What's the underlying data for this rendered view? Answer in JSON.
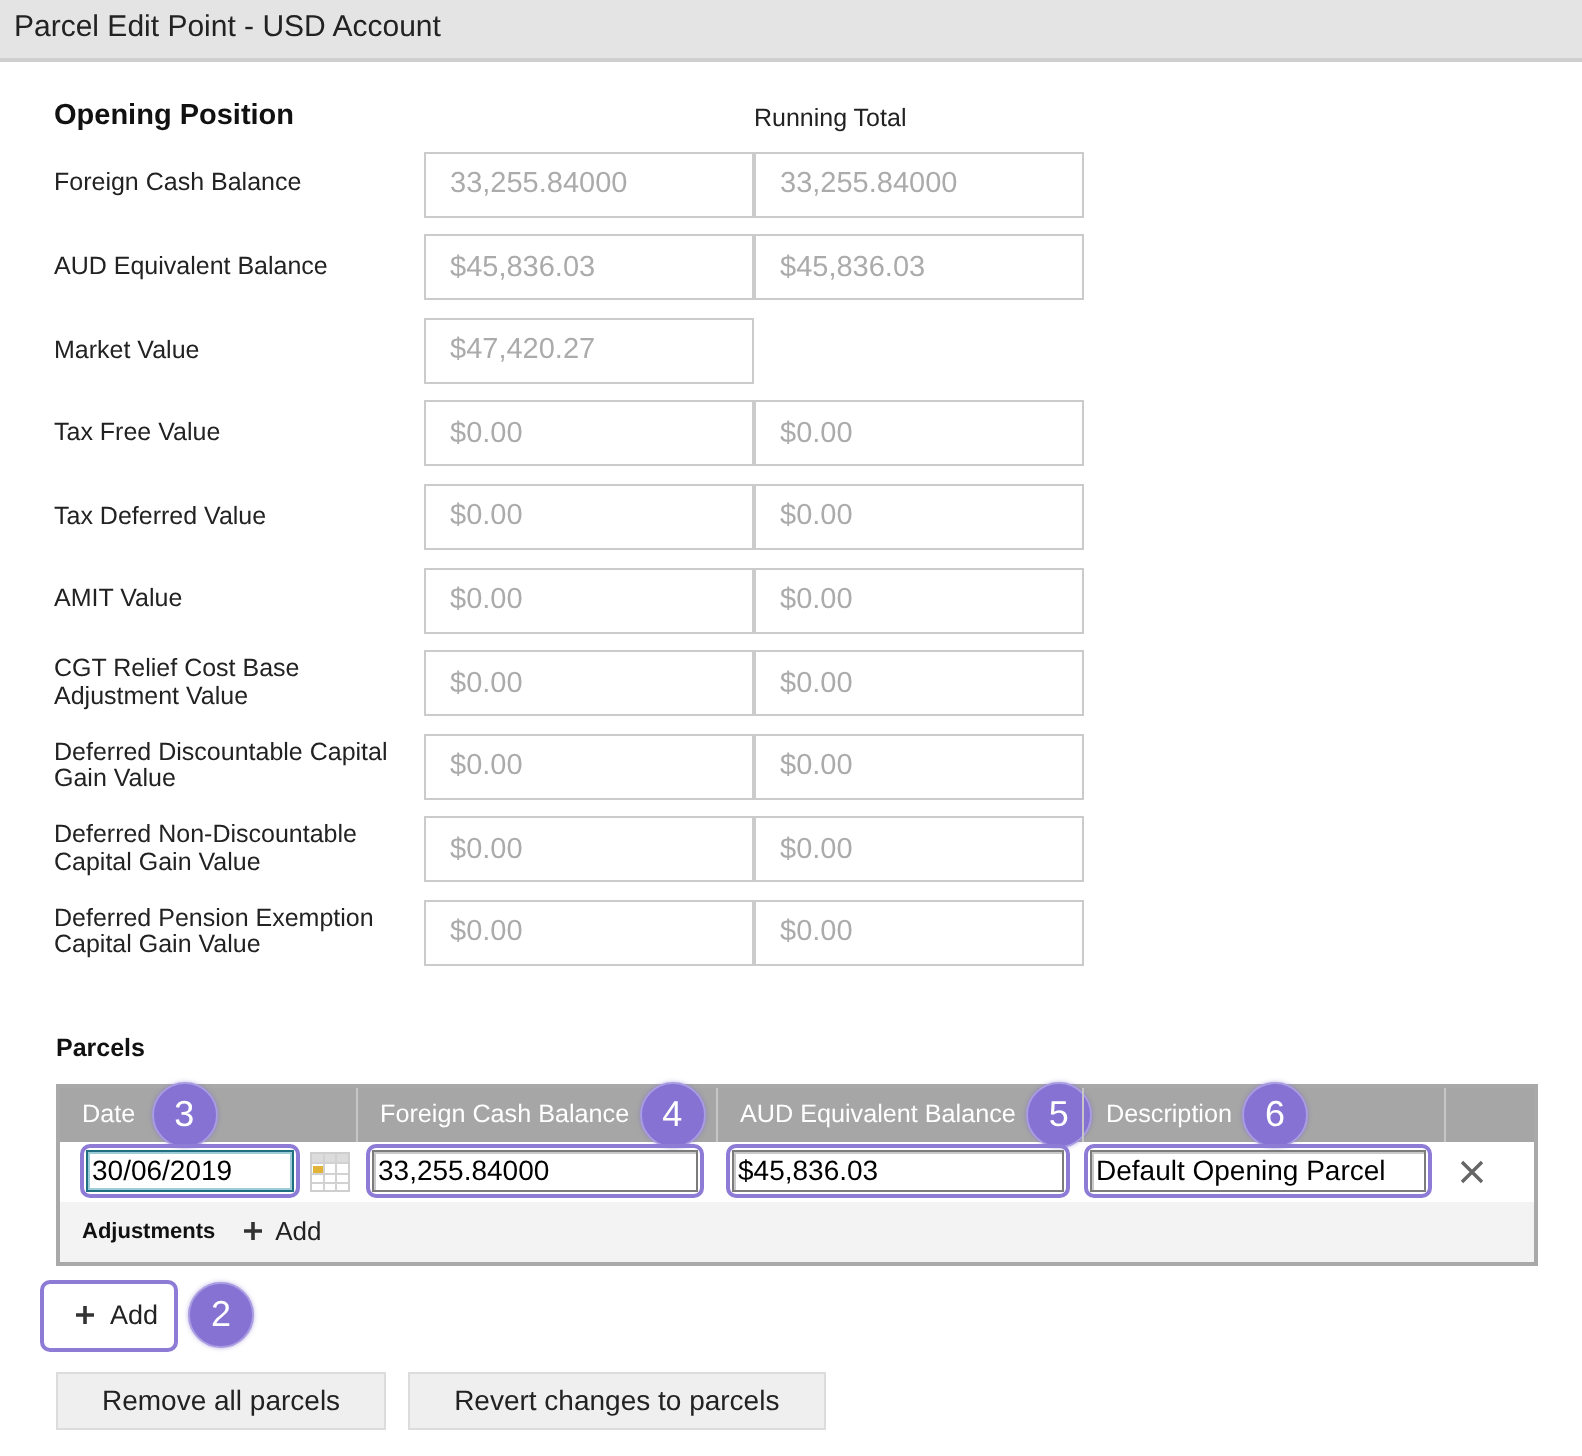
{
  "window": {
    "title": "Parcel Edit Point - USD Account"
  },
  "opening_position": {
    "heading": "Opening Position",
    "running_total_label": "Running Total",
    "rows": [
      {
        "label": "Foreign Cash Balance",
        "value": "33,255.84000",
        "running_total": "33,255.84000",
        "disabled": true
      },
      {
        "label": "AUD Equivalent Balance",
        "value": "$45,836.03",
        "running_total": "$45,836.03",
        "disabled": true
      },
      {
        "label": "Market Value",
        "value": "$47,420.27",
        "disabled": true
      },
      {
        "label": "Tax Free Value",
        "value": "$0.00",
        "running_total": "$0.00",
        "disabled": true
      },
      {
        "label": "Tax Deferred Value",
        "value": "$0.00",
        "running_total": "$0.00",
        "disabled": true
      },
      {
        "label": "AMIT Value",
        "value": "$0.00",
        "running_total": "$0.00",
        "disabled": true
      },
      {
        "label": "CGT Relief Cost Base Adjustment Value",
        "value": "$0.00",
        "running_total": "$0.00",
        "disabled": true
      },
      {
        "label": "Deferred Discountable Capital Gain Value",
        "value": "$0.00",
        "running_total": "$0.00",
        "disabled": true
      },
      {
        "label": "Deferred Non-Discountable Capital Gain Value",
        "value": "$0.00",
        "running_total": "$0.00",
        "disabled": true
      },
      {
        "label": "Deferred Pension Exemption Capital Gain Value",
        "value": "$0.00",
        "running_total": "$0.00",
        "disabled": true
      }
    ]
  },
  "parcels": {
    "heading": "Parcels",
    "columns": [
      {
        "label": "Date",
        "callout": "3"
      },
      {
        "label": "Foreign Cash Balance",
        "callout": "4"
      },
      {
        "label": "AUD Equivalent Balance",
        "callout": "5"
      },
      {
        "label": "Description",
        "callout": "6"
      }
    ],
    "rows": [
      {
        "fields": [
          {
            "kind": "date",
            "value": "30/06/2019",
            "highlighted": true,
            "focused": true
          },
          {
            "kind": "text",
            "value": "33,255.84000",
            "highlighted": true,
            "focused": false
          },
          {
            "kind": "text",
            "value": "$45,836.03",
            "highlighted": true,
            "focused": false
          },
          {
            "kind": "text",
            "value": "Default Opening Parcel",
            "highlighted": true,
            "focused": false
          }
        ],
        "adjustments_label": "Adjustments",
        "add_adjustment_label": "Add"
      }
    ],
    "add_button": {
      "label": "Add",
      "callout": "2",
      "highlighted": true
    }
  },
  "buttons": [
    "Remove all parcels",
    "Revert changes to parcels"
  ]
}
